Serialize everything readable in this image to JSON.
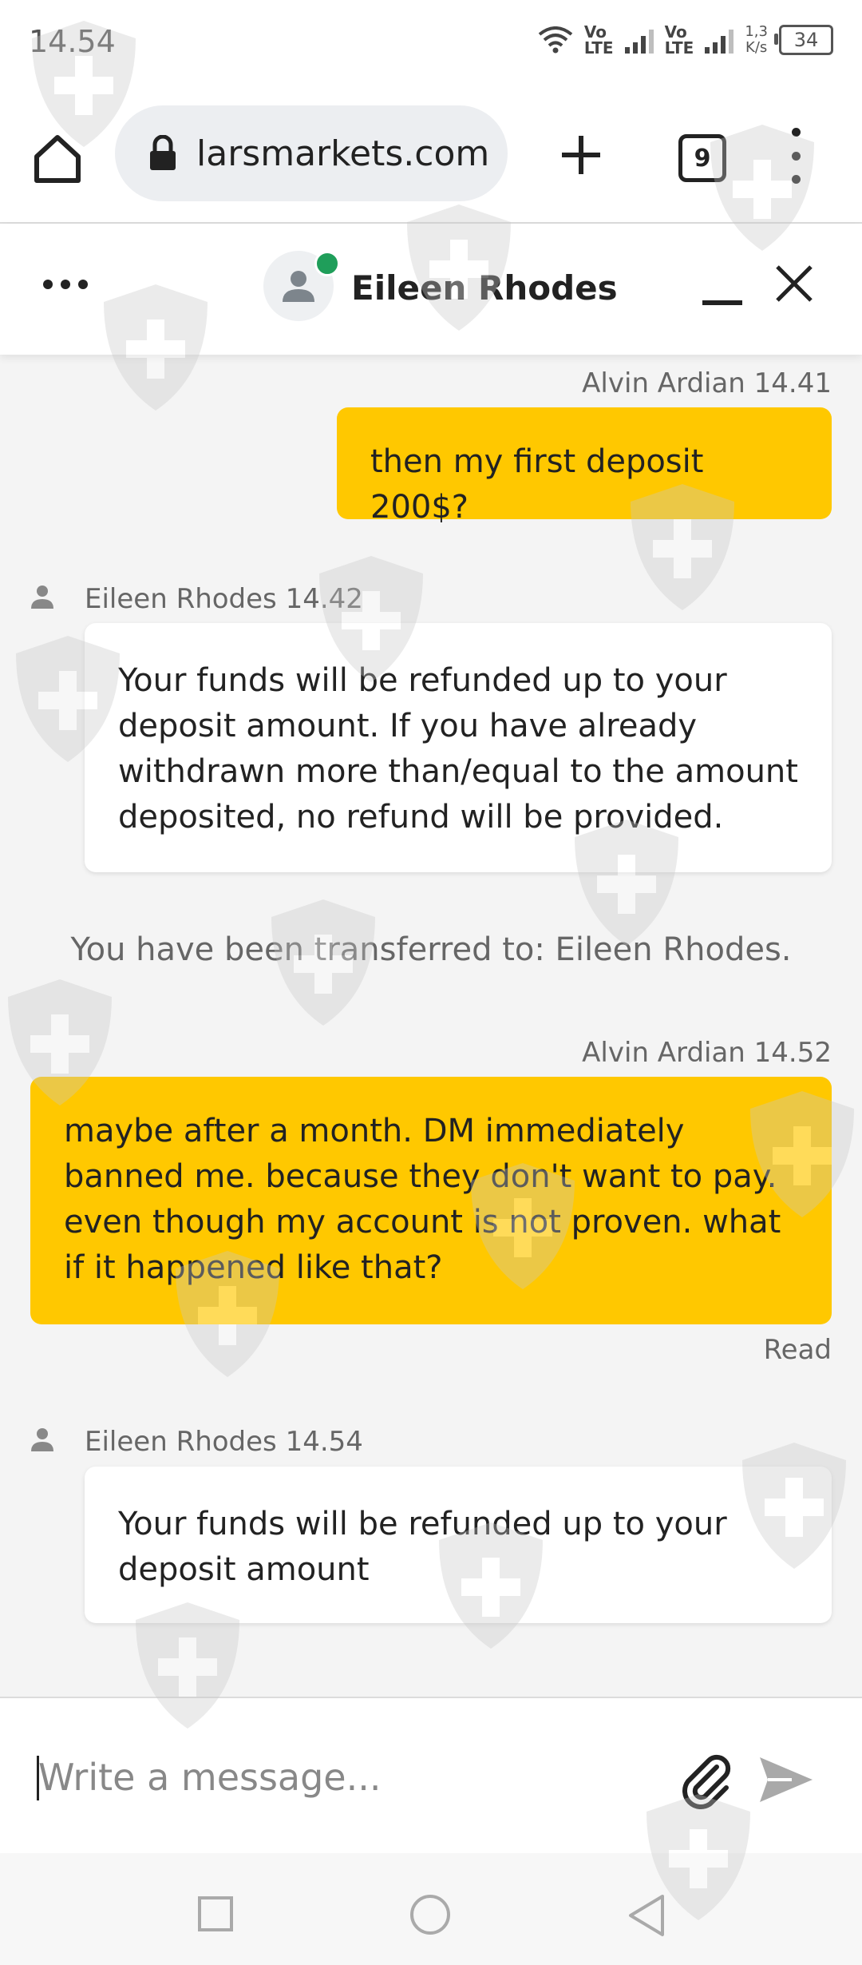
{
  "status_bar": {
    "time": "14.54",
    "sim1_label_top": "Vo",
    "sim1_label_bottom": "LTE",
    "sim2_label_top": "Vo",
    "sim2_label_bottom": "LTE",
    "speed_value": "1,3",
    "speed_unit": "K/s",
    "battery": "34",
    "icons": [
      "wifi-icon",
      "signal-icon",
      "signal-icon",
      "battery-icon"
    ]
  },
  "browser": {
    "url": "larsmarkets.com",
    "tab_count": "9",
    "icons": [
      "home-icon",
      "lock-icon",
      "plus-icon",
      "tabs-icon",
      "more-vert-icon"
    ]
  },
  "chat_header": {
    "agent_name": "Eileen Rhodes",
    "online_color": "#1f9e5a",
    "icons": [
      "more-horiz-icon",
      "avatar-icon",
      "minimize-icon",
      "close-icon"
    ]
  },
  "messages": [
    {
      "sender": "user",
      "meta": "Alvin Ardian 14.41",
      "text": "then my first deposit 200$?"
    },
    {
      "sender": "agent",
      "meta": "Eileen Rhodes 14.42",
      "text": "Your funds will be refunded up to your deposit amount. If you have already withdrawn more than/equal to the amount deposited, no refund will be provided."
    },
    {
      "sender": "system",
      "text": "You have been transferred to: Eileen Rhodes."
    },
    {
      "sender": "user",
      "meta": "Alvin Ardian 14.52",
      "text": "maybe after a month. DM immediately banned me. because they don't want to pay. even though my account is not proven. what if it happened like that?",
      "status": "Read"
    },
    {
      "sender": "agent",
      "meta": "Eileen Rhodes 14.54",
      "text": "Your funds will be refunded up to your deposit amount"
    }
  ],
  "composer": {
    "placeholder": "Write a message...",
    "value": "",
    "icons": [
      "paperclip-icon",
      "send-icon"
    ]
  },
  "nav_bar": {
    "icons": [
      "recents-icon",
      "home-circle-icon",
      "back-icon"
    ]
  },
  "colors": {
    "user_bubble": "#ffc800",
    "agent_bubble": "#ffffff",
    "background": "#f4f4f4"
  }
}
